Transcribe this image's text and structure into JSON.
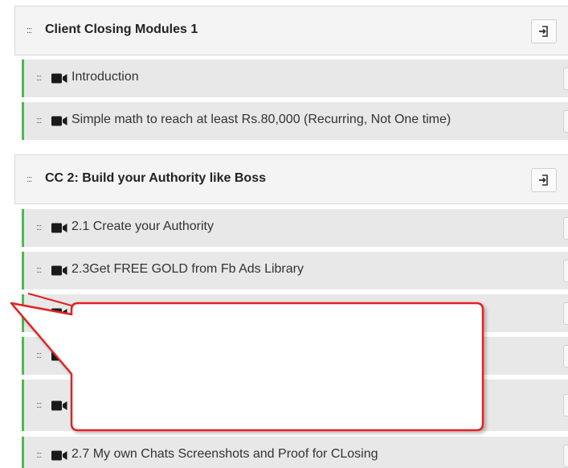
{
  "modules": [
    {
      "title": "Client Closing Modules 1",
      "drag_handle": ":::",
      "export_icon": "import-icon",
      "lessons": [
        {
          "label": "Introduction",
          "icon": "video-camera-icon"
        },
        {
          "label": "Simple math to reach at least Rs.80,000 (Recurring, Not One time)",
          "icon": "video-camera-icon"
        }
      ]
    },
    {
      "title": "CC 2: Build your Authority like Boss",
      "drag_handle": ":::",
      "export_icon": "import-icon",
      "lessons": [
        {
          "label": "2.1 Create your Authority",
          "icon": "video-camera-icon"
        },
        {
          "label": "2.3Get FREE GOLD from Fb Ads Library",
          "icon": "video-camera-icon"
        },
        {
          "label": "",
          "icon": "video-camera-icon"
        },
        {
          "label": "",
          "icon": "video-camera-icon"
        },
        {
          "label": "",
          "icon": "video-camera-icon"
        },
        {
          "label": "2.7 My own Chats Screenshots and Proof for CLosing",
          "icon": "video-camera-icon"
        }
      ]
    }
  ],
  "callout": {
    "text": "",
    "border_color": "#e02020",
    "fill_color": "#ffffff"
  },
  "colors": {
    "accent_green": "#4cbb4a",
    "header_bg": "#f4f4f4",
    "row_bg": "#e8e8e8"
  }
}
